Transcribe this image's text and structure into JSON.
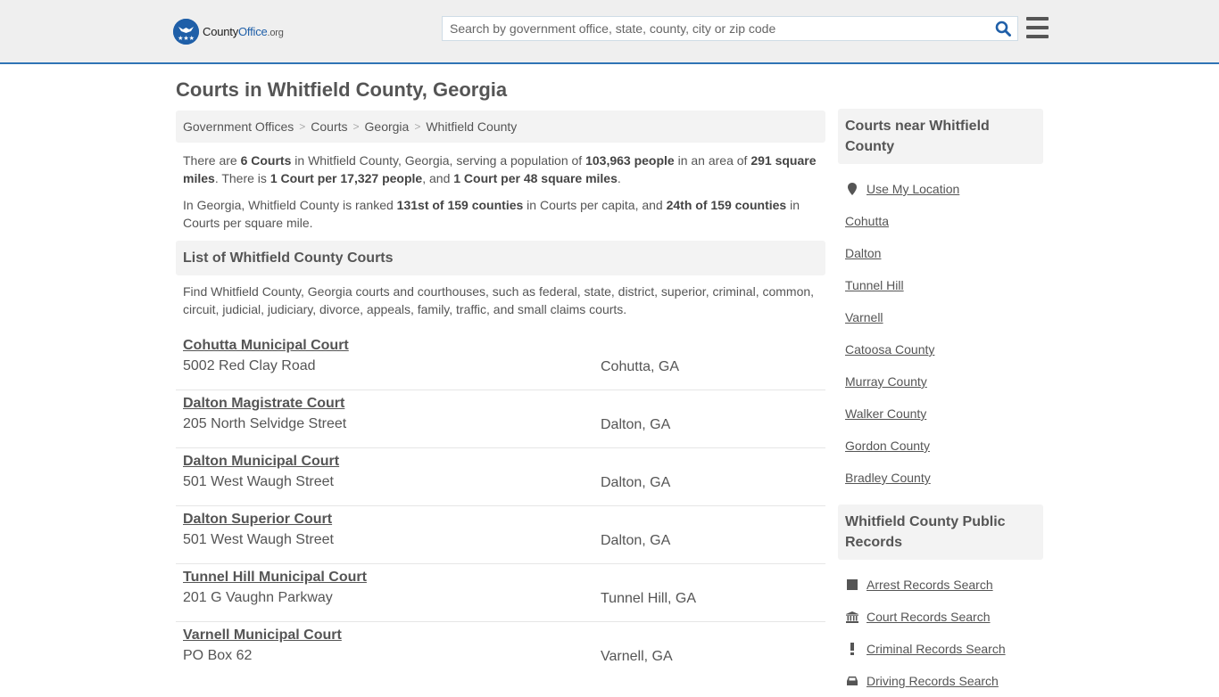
{
  "header": {
    "logo_main": "County",
    "logo_office": "Office",
    "logo_tld": ".org",
    "search_placeholder": "Search by government office, state, county, city or zip code",
    "search_icon": "search-icon",
    "menu_icon": "hamburger-menu-icon"
  },
  "page": {
    "title": "Courts in Whitfield County, Georgia"
  },
  "breadcrumb": [
    {
      "label": "Government Offices"
    },
    {
      "label": "Courts"
    },
    {
      "label": "Georgia"
    },
    {
      "label": "Whitfield County"
    }
  ],
  "breadcrumb_separator": ">",
  "intro": {
    "p1": {
      "t1": "There are ",
      "b1": "6 Courts",
      "t2": " in Whitfield County, Georgia, serving a population of ",
      "b2": "103,963 people",
      "t3": " in an area of ",
      "b3": "291 square miles",
      "t4": ". There is ",
      "b4": "1 Court per 17,327 people",
      "t5": ", and ",
      "b5": "1 Court per 48 square miles",
      "t6": "."
    },
    "p2": {
      "t1": "In Georgia, Whitfield County is ranked ",
      "b1": "131st of 159 counties",
      "t2": " in Courts per capita, and ",
      "b2": "24th of 159 counties",
      "t3": " in Courts per square mile."
    }
  },
  "list": {
    "heading": "List of Whitfield County Courts",
    "description": "Find Whitfield County, Georgia courts and courthouses, such as federal, state, district, superior, criminal, common, circuit, judicial, judiciary, divorce, appeals, family, traffic, and small claims courts.",
    "courts": [
      {
        "name": "Cohutta Municipal Court",
        "address": "5002 Red Clay Road",
        "city": "Cohutta, GA"
      },
      {
        "name": "Dalton Magistrate Court",
        "address": "205 North Selvidge Street",
        "city": "Dalton, GA"
      },
      {
        "name": "Dalton Municipal Court",
        "address": "501 West Waugh Street",
        "city": "Dalton, GA"
      },
      {
        "name": "Dalton Superior Court",
        "address": "501 West Waugh Street",
        "city": "Dalton, GA"
      },
      {
        "name": "Tunnel Hill Municipal Court",
        "address": "201 G Vaughn Parkway",
        "city": "Tunnel Hill, GA"
      },
      {
        "name": "Varnell Municipal Court",
        "address": "PO Box 62",
        "city": "Varnell, GA"
      }
    ]
  },
  "sidebar": {
    "nearby_heading": "Courts near Whitfield County",
    "use_location": "Use My Location",
    "nearby": [
      {
        "label": "Cohutta"
      },
      {
        "label": "Dalton"
      },
      {
        "label": "Tunnel Hill"
      },
      {
        "label": "Varnell"
      },
      {
        "label": "Catoosa County"
      },
      {
        "label": "Murray County"
      },
      {
        "label": "Walker County"
      },
      {
        "label": "Gordon County"
      },
      {
        "label": "Bradley County"
      }
    ],
    "records_heading": "Whitfield County Public Records",
    "records": [
      {
        "label": "Arrest Records Search",
        "icon": "square-icon"
      },
      {
        "label": "Court Records Search",
        "icon": "courthouse-icon"
      },
      {
        "label": "Criminal Records Search",
        "icon": "exclamation-icon"
      },
      {
        "label": "Driving Records Search",
        "icon": "car-icon"
      }
    ]
  },
  "colors": {
    "brand_blue": "#1f5fa8",
    "header_border": "#2f74b5",
    "text": "#555555",
    "panel_bg": "#f3f3f3"
  }
}
